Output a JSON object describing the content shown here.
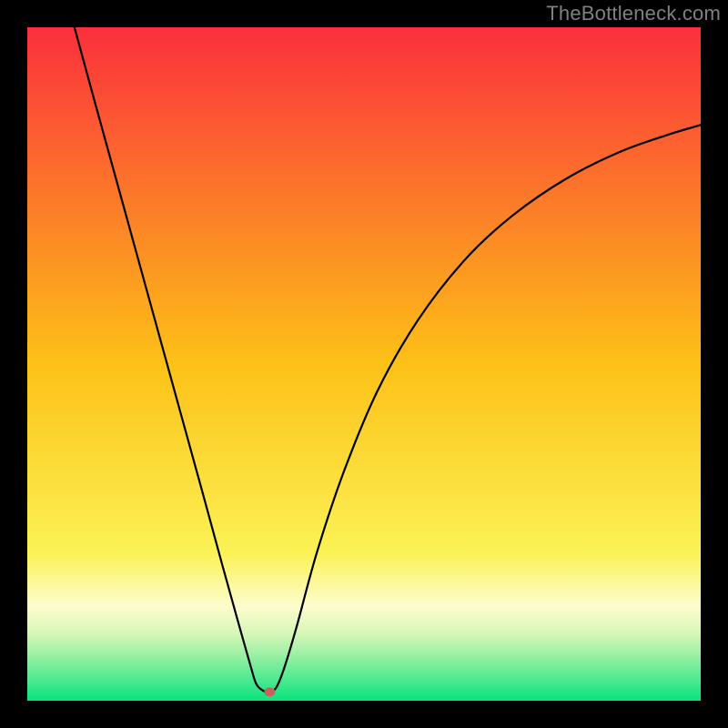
{
  "watermark": "TheBottleneck.com",
  "chart_data": {
    "type": "line",
    "title": "",
    "xlabel": "",
    "ylabel": "",
    "xlim": [
      0,
      100
    ],
    "ylim": [
      0,
      100
    ],
    "background_gradient": {
      "stops": [
        {
          "offset": 0.0,
          "color": "#fb2f3c"
        },
        {
          "offset": 0.5,
          "color": "#fdc117"
        },
        {
          "offset": 0.78,
          "color": "#fbf255"
        },
        {
          "offset": 0.86,
          "color": "#fdfdce"
        },
        {
          "offset": 0.9,
          "color": "#d6f7b7"
        },
        {
          "offset": 0.94,
          "color": "#8beea0"
        },
        {
          "offset": 1.0,
          "color": "#08e47e"
        }
      ]
    },
    "series": [
      {
        "name": "bottleneck-curve",
        "stroke": "#000000",
        "stroke_width": 2.2,
        "x": [
          7.0,
          10.0,
          14.0,
          18.0,
          22.0,
          26.0,
          29.0,
          31.5,
          33.2,
          34.0,
          35.0,
          36.0,
          37.0,
          38.2,
          40.0,
          43.0,
          47.0,
          52.0,
          58.0,
          65.0,
          72.0,
          80.0,
          88.0,
          95.0,
          100.0
        ],
        "y": [
          100.0,
          89.0,
          74.5,
          60.0,
          45.5,
          31.0,
          20.0,
          11.0,
          5.0,
          2.5,
          1.5,
          1.3,
          2.0,
          5.0,
          11.0,
          22.0,
          34.0,
          46.0,
          56.5,
          65.5,
          72.0,
          77.5,
          81.5,
          84.0,
          85.5
        ]
      }
    ],
    "marker": {
      "name": "min-point",
      "x": 36.0,
      "y": 1.3,
      "rx": 6,
      "ry": 5,
      "fill": "#c9625c"
    }
  }
}
